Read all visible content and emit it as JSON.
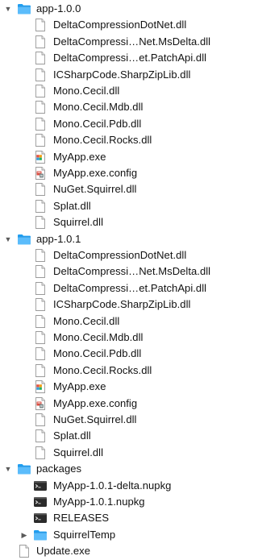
{
  "rows": [
    {
      "label": "app-1.0.0",
      "icon": "folder-icon",
      "level": 0,
      "disclosure": "expanded"
    },
    {
      "label": "DeltaCompressionDotNet.dll",
      "icon": "document-icon",
      "level": 1
    },
    {
      "label": "DeltaCompressi…Net.MsDelta.dll",
      "icon": "document-icon",
      "level": 1
    },
    {
      "label": "DeltaCompressi…et.PatchApi.dll",
      "icon": "document-icon",
      "level": 1
    },
    {
      "label": "ICSharpCode.SharpZipLib.dll",
      "icon": "document-icon",
      "level": 1
    },
    {
      "label": "Mono.Cecil.dll",
      "icon": "document-icon",
      "level": 1
    },
    {
      "label": "Mono.Cecil.Mdb.dll",
      "icon": "document-icon",
      "level": 1
    },
    {
      "label": "Mono.Cecil.Pdb.dll",
      "icon": "document-icon",
      "level": 1
    },
    {
      "label": "Mono.Cecil.Rocks.dll",
      "icon": "document-icon",
      "level": 1
    },
    {
      "label": "MyApp.exe",
      "icon": "exe-icon",
      "level": 1
    },
    {
      "label": "MyApp.exe.config",
      "icon": "config-icon",
      "level": 1
    },
    {
      "label": "NuGet.Squirrel.dll",
      "icon": "document-icon",
      "level": 1
    },
    {
      "label": "Splat.dll",
      "icon": "document-icon",
      "level": 1
    },
    {
      "label": "Squirrel.dll",
      "icon": "document-icon",
      "level": 1
    },
    {
      "label": "app-1.0.1",
      "icon": "folder-icon",
      "level": 0,
      "disclosure": "expanded"
    },
    {
      "label": "DeltaCompressionDotNet.dll",
      "icon": "document-icon",
      "level": 1
    },
    {
      "label": "DeltaCompressi…Net.MsDelta.dll",
      "icon": "document-icon",
      "level": 1
    },
    {
      "label": "DeltaCompressi…et.PatchApi.dll",
      "icon": "document-icon",
      "level": 1
    },
    {
      "label": "ICSharpCode.SharpZipLib.dll",
      "icon": "document-icon",
      "level": 1
    },
    {
      "label": "Mono.Cecil.dll",
      "icon": "document-icon",
      "level": 1
    },
    {
      "label": "Mono.Cecil.Mdb.dll",
      "icon": "document-icon",
      "level": 1
    },
    {
      "label": "Mono.Cecil.Pdb.dll",
      "icon": "document-icon",
      "level": 1
    },
    {
      "label": "Mono.Cecil.Rocks.dll",
      "icon": "document-icon",
      "level": 1
    },
    {
      "label": "MyApp.exe",
      "icon": "exe-icon",
      "level": 1
    },
    {
      "label": "MyApp.exe.config",
      "icon": "config-icon",
      "level": 1
    },
    {
      "label": "NuGet.Squirrel.dll",
      "icon": "document-icon",
      "level": 1
    },
    {
      "label": "Splat.dll",
      "icon": "document-icon",
      "level": 1
    },
    {
      "label": "Squirrel.dll",
      "icon": "document-icon",
      "level": 1
    },
    {
      "label": "packages",
      "icon": "folder-icon",
      "level": 0,
      "disclosure": "expanded"
    },
    {
      "label": "MyApp-1.0.1-delta.nupkg",
      "icon": "terminal-file-icon",
      "level": 1
    },
    {
      "label": "MyApp-1.0.1.nupkg",
      "icon": "terminal-file-icon",
      "level": 1
    },
    {
      "label": "RELEASES",
      "icon": "terminal-file-icon",
      "level": 1
    },
    {
      "label": "SquirrelTemp",
      "icon": "folder-icon",
      "level": 1,
      "disclosure": "collapsed"
    },
    {
      "label": "Update.exe",
      "icon": "document-icon",
      "level": 0
    }
  ]
}
